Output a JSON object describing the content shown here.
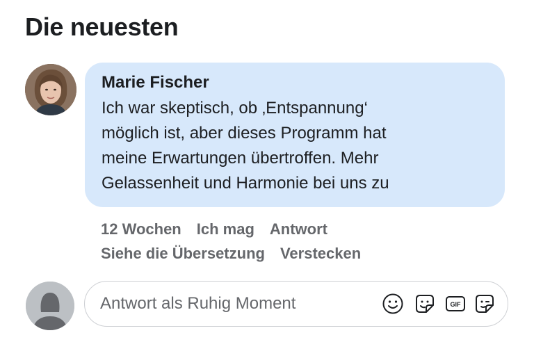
{
  "section": {
    "title": "Die neuesten"
  },
  "comment": {
    "author": "Marie Fischer",
    "text": "Ich war skeptisch, ob ‚Entspannung‘\nmöglich ist, aber dieses Programm hat\nmeine Erwartungen übertroffen. Mehr\nGelassenheit und Harmonie bei uns zu",
    "time": "12 Wochen",
    "like_label": "Ich mag",
    "reply_label": "Antwort",
    "translation_label": "Siehe die Übersetzung",
    "hide_label": "Verstecken"
  },
  "reply": {
    "placeholder": "Antwort als Ruhig Moment",
    "icons": [
      "emoji-icon",
      "sticker-icon",
      "gif-icon",
      "avatar-sticker-icon"
    ],
    "gif_label": "GIF"
  },
  "colors": {
    "bubble": "#d7e8fb",
    "action_text": "#65676b",
    "input_border": "#ced0d4"
  }
}
